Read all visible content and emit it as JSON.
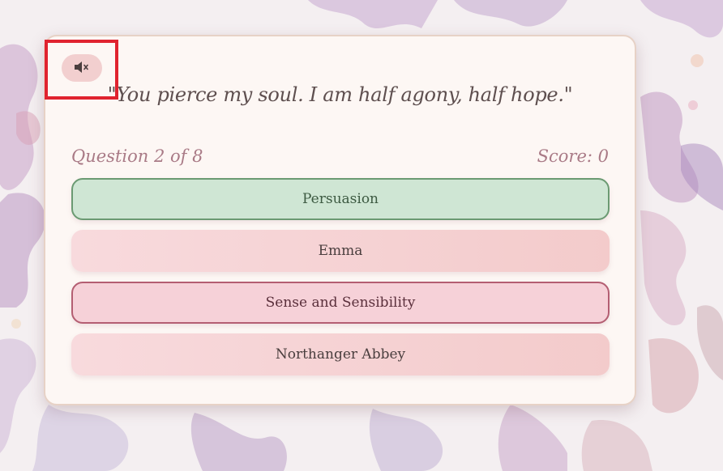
{
  "quiz": {
    "quote": "\"You pierce my soul. I am half agony, half hope.\"",
    "question_label": "Question 2 of 8",
    "score_label": "Score: 0",
    "options": [
      {
        "label": "Persuasion",
        "state": "correct"
      },
      {
        "label": "Emma",
        "state": "neutral"
      },
      {
        "label": "Sense and Sensibility",
        "state": "incorrect"
      },
      {
        "label": "Northanger Abbey",
        "state": "neutral"
      }
    ]
  },
  "sound": {
    "icon": "speaker-muted-icon",
    "muted": true
  },
  "colors": {
    "card_bg": "#fdf7f4",
    "correct_bg": "#cfe6d4",
    "correct_border": "#6b9a72",
    "incorrect_bg": "#f6d1d8",
    "incorrect_border": "#b45e72",
    "option_bg": "#f6d4d6",
    "accent_text": "#a97a86",
    "highlight_box": "#e0232f"
  }
}
